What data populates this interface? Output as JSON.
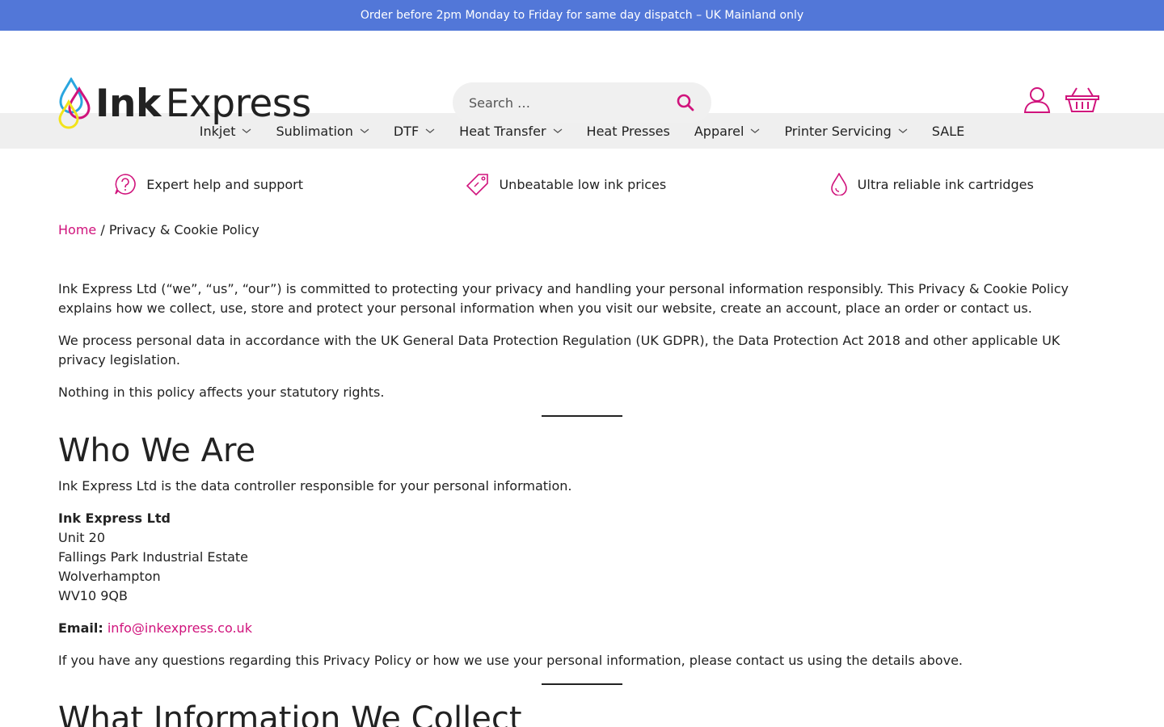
{
  "topbar": {
    "text": "Order before 2pm Monday to Friday for same day dispatch – UK Mainland only"
  },
  "logo": {
    "bold": "Ink",
    "light": "Express"
  },
  "search": {
    "placeholder": "Search …"
  },
  "nav": {
    "items": [
      {
        "label": "Inkjet",
        "dropdown": true
      },
      {
        "label": "Sublimation",
        "dropdown": true
      },
      {
        "label": "DTF",
        "dropdown": true
      },
      {
        "label": "Heat Transfer",
        "dropdown": true
      },
      {
        "label": "Heat Presses",
        "dropdown": false
      },
      {
        "label": "Apparel",
        "dropdown": true
      },
      {
        "label": "Printer Servicing",
        "dropdown": true
      },
      {
        "label": "SALE",
        "dropdown": false
      }
    ]
  },
  "features": [
    {
      "icon": "question-icon",
      "label": "Expert help and support"
    },
    {
      "icon": "price-tag-icon",
      "label": "Unbeatable low ink prices"
    },
    {
      "icon": "ink-drop-icon",
      "label": "Ultra reliable ink cartridges"
    }
  ],
  "breadcrumb": {
    "home": "Home",
    "separator": " / ",
    "current": "Privacy & Cookie Policy"
  },
  "intro": {
    "p1": "Ink Express Ltd (“we”, “us”, “our”) is committed to protecting your privacy and handling your personal information responsibly. This Privacy & Cookie Policy explains how we collect, use, store and protect your personal information when you visit our website, create an account, place an order or contact us.",
    "p2": "We process personal data in accordance with the UK General Data Protection Regulation (UK GDPR), the Data Protection Act 2018 and other applicable UK privacy legislation.",
    "p3": "Nothing in this policy affects your statutory rights."
  },
  "who": {
    "heading": "Who We Are",
    "p1": "Ink Express Ltd is the data controller responsible for your personal information.",
    "address": {
      "name": "Ink Express Ltd",
      "line1": "Unit 20",
      "line2": "Fallings Park Industrial Estate",
      "line3": "Wolverhampton",
      "postcode": "WV10 9QB"
    },
    "email_label": "Email:",
    "email": "info@inkexpress.co.uk",
    "p2": "If you have any questions regarding this Privacy Policy or how we use your personal information, please contact us using the details above."
  },
  "collect": {
    "heading": "What Information We Collect"
  },
  "colors": {
    "accent": "#d0137c",
    "topbar": "#5277d8",
    "nav_bg": "#efefef"
  }
}
